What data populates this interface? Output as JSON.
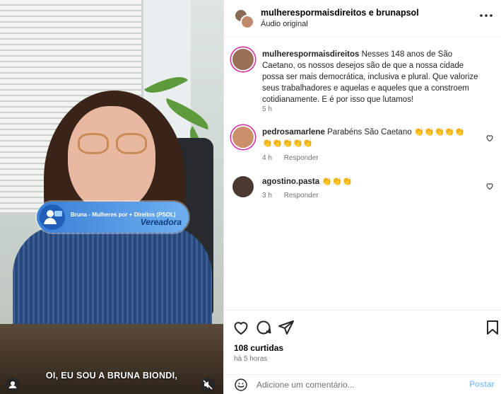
{
  "video": {
    "lower_third_name": "Bruna - Mulheres por + Direitos (PSOL)",
    "lower_third_role": "Vereadora",
    "caption": "OI, EU SOU A BRUNA BIONDI,"
  },
  "header": {
    "title": "mulherespormaisdireitos e brunapsol",
    "subtitle": "Áudio original",
    "more_icon": "more-horizontal-icon"
  },
  "caption_comment": {
    "user": "mulherespormaisdireitos",
    "text": "Nesses 148 anos de São Caetano, os nossos desejos são de que a nossa cidade possa ser mais democrática, inclusiva e plural. Que valorize seus trabalhadores e aquelas e aqueles que a constroem cotidianamente. E é por isso que lutamos!",
    "time": "5 h"
  },
  "comments": [
    {
      "user": "pedrosamarlene",
      "text": "Parabéns São Caetano 👏👏👏👏👏👏👏👏👏👏",
      "time": "4 h",
      "reply_label": "Responder"
    },
    {
      "user": "agostino.pasta",
      "text": "👏👏👏",
      "time": "3 h",
      "reply_label": "Responder"
    }
  ],
  "actions": {
    "likes": "108 curtidas",
    "time_ago": "há 5 horas",
    "icons": [
      "heart-icon",
      "comment-icon",
      "share-icon",
      "bookmark-icon"
    ]
  },
  "add_comment": {
    "placeholder": "Adicione um comentário...",
    "post_label": "Postar"
  },
  "colors": {
    "accent_link": "#8ec7f7",
    "ring": "#d6249f",
    "muted": "#737373"
  }
}
